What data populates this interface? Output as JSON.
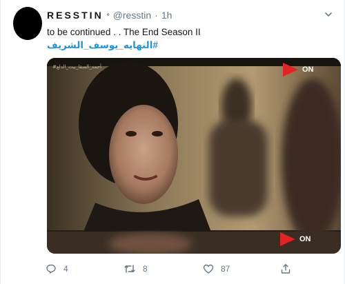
{
  "tweet": {
    "display_name": "RESSTIN",
    "name_mark": "°",
    "handle": "@resstin",
    "separator": "·",
    "time": "1h",
    "text": "to be continued . . The End Season II",
    "hashtag": "#النهايه_يوسف_الشريف"
  },
  "media": {
    "channel_logo_text": "ON",
    "channel_logo_color": "#e3231f",
    "watermark_text": "#أحمد_السقا_بيت_الدلع"
  },
  "actions": {
    "reply_count": "4",
    "retweet_count": "8",
    "like_count": "87"
  },
  "icons": {
    "reply": "reply-icon",
    "retweet": "retweet-icon",
    "like": "heart-icon",
    "share": "share-icon",
    "menu": "chevron-down-icon"
  },
  "colors": {
    "link": "#1b95e0",
    "muted": "#657786",
    "text": "#14171a"
  }
}
